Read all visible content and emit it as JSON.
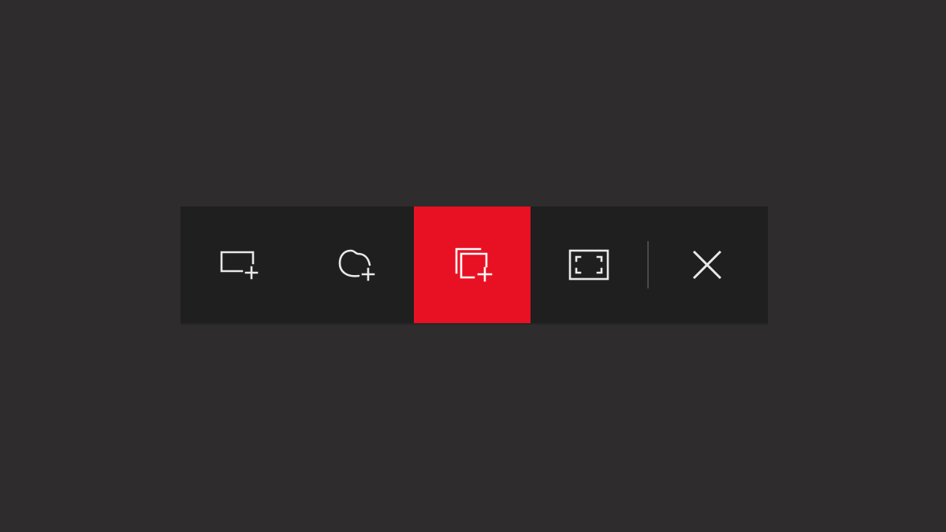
{
  "toolbar": {
    "active_color": "#e81123",
    "background_color": "#1f1f1f",
    "tools": [
      {
        "icon": "rectangular-snip-icon",
        "selected": false
      },
      {
        "icon": "freeform-snip-icon",
        "selected": false
      },
      {
        "icon": "window-snip-icon",
        "selected": true
      },
      {
        "icon": "fullscreen-snip-icon",
        "selected": false
      }
    ],
    "close_icon": "close-icon"
  }
}
